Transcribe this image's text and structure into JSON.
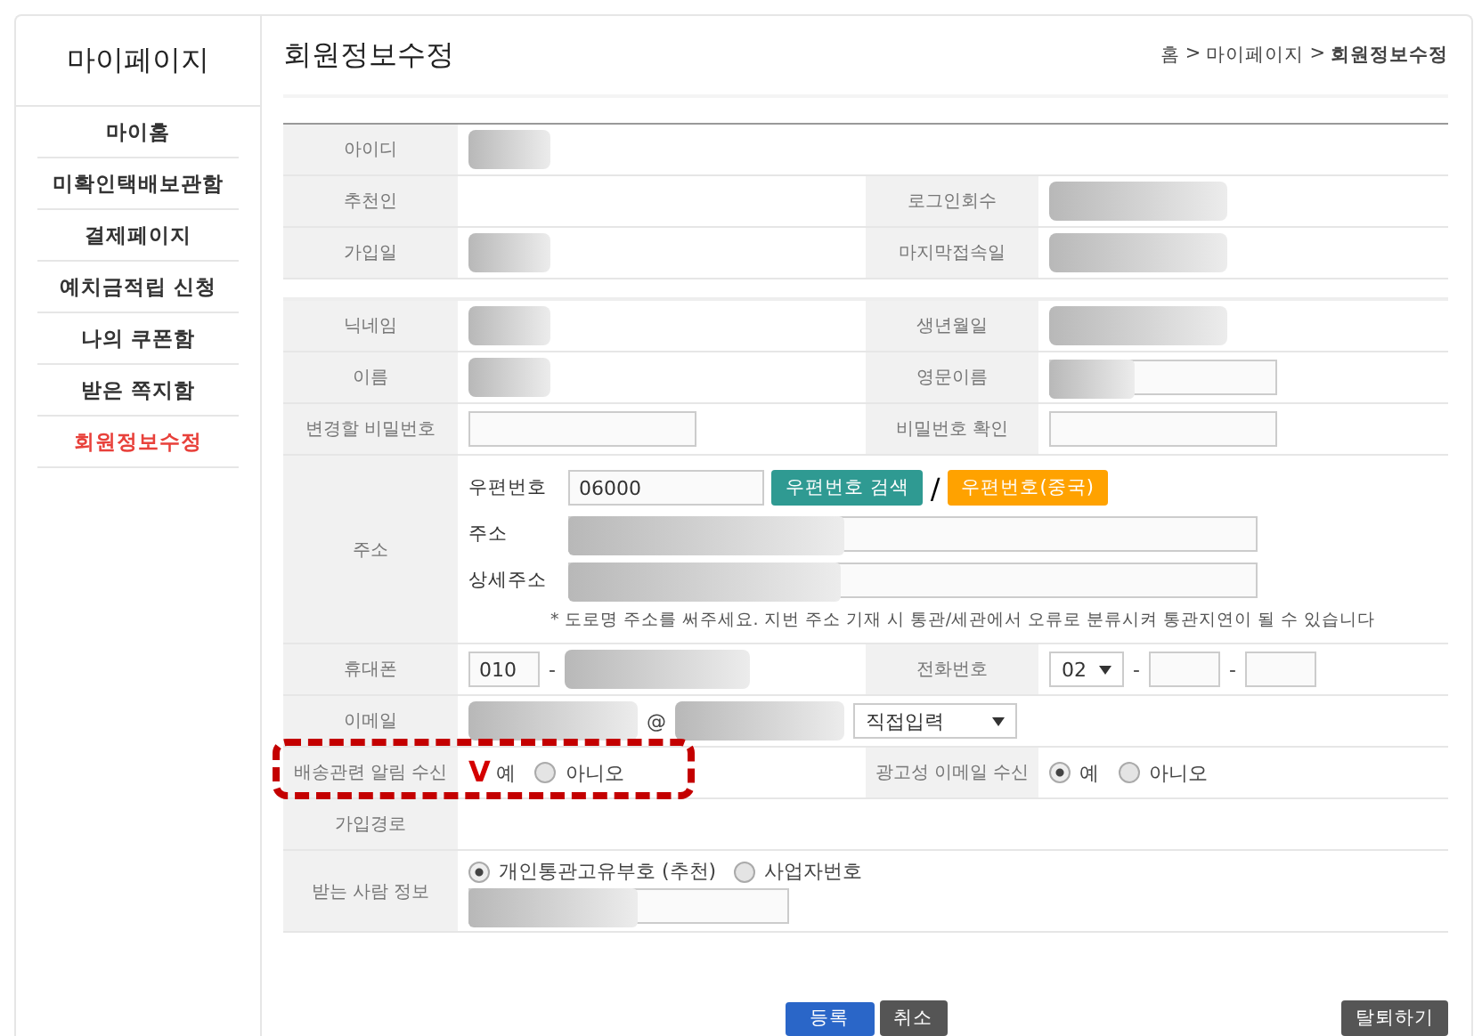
{
  "sidebar": {
    "title": "마이페이지",
    "items": [
      {
        "label": "마이홈",
        "selected": false
      },
      {
        "label": "미확인택배보관함",
        "selected": false
      },
      {
        "label": "결제페이지",
        "selected": false
      },
      {
        "label": "예치금적립 신청",
        "selected": false
      },
      {
        "label": "나의 쿠폰함",
        "selected": false
      },
      {
        "label": "받은 쪽지함",
        "selected": false
      },
      {
        "label": "회원정보수정",
        "selected": true
      }
    ]
  },
  "page_title": "회원정보수정",
  "breadcrumb": {
    "separator": ">",
    "items": [
      {
        "label": "홈",
        "current": false
      },
      {
        "label": "마이페이지",
        "current": false
      },
      {
        "label": "회원정보수정",
        "current": true
      }
    ]
  },
  "sections": [
    {
      "rows": [
        {
          "cells": [
            {
              "label": "아이디",
              "field": {
                "kind": "redacted"
              }
            }
          ]
        },
        {
          "cells": [
            {
              "label": "추천인",
              "field": {
                "kind": "blank"
              }
            },
            {
              "label": "로그인회수",
              "field": {
                "kind": "redacted"
              }
            }
          ]
        },
        {
          "cells": [
            {
              "label": "가입일",
              "field": {
                "kind": "redacted"
              }
            },
            {
              "label": "마지막접속일",
              "field": {
                "kind": "redacted"
              }
            }
          ]
        }
      ]
    },
    {
      "rows": [
        {
          "cells": [
            {
              "label": "닉네임",
              "field": {
                "kind": "redacted"
              }
            },
            {
              "label": "생년월일",
              "field": {
                "kind": "redacted"
              }
            }
          ]
        },
        {
          "cells": [
            {
              "label": "이름",
              "field": {
                "kind": "redacted"
              }
            },
            {
              "label": "영문이름",
              "field": {
                "kind": "input",
                "redacted": true
              }
            }
          ]
        },
        {
          "cells": [
            {
              "label": "변경할 비밀번호",
              "field": {
                "kind": "input",
                "redacted": false
              }
            },
            {
              "label": "비밀번호 확인",
              "field": {
                "kind": "input",
                "redacted": false
              }
            }
          ]
        },
        {
          "cells": [
            {
              "label": "주소",
              "field": {
                "kind": "address",
                "zip_label": "우편번호",
                "zip": "06000",
                "search_button": "우편번호 검색",
                "slash": "/",
                "china_button": "우편번호(중국)",
                "address_label": "주소",
                "detail_label": "상세주소",
                "note": "* 도로명 주소를 써주세요. 지번 주소 기재 시 통관/세관에서 오류로 분류시켜 통관지연이 될 수 있습니다"
              }
            }
          ]
        },
        {
          "cells": [
            {
              "label": "휴대폰",
              "field": {
                "kind": "mobile",
                "prefix": "010",
                "dash": "-"
              }
            },
            {
              "label": "전화번호",
              "field": {
                "kind": "tel",
                "area": "02",
                "dash": "-"
              }
            }
          ]
        },
        {
          "cells": [
            {
              "label": "이메일",
              "field": {
                "kind": "email",
                "at": "@",
                "domain": "직접입력"
              }
            }
          ]
        },
        {
          "annotation": {
            "mark": "V"
          },
          "cells": [
            {
              "label": "배송관련 알림 수신",
              "field": {
                "kind": "radio",
                "options": [
                  {
                    "label": "예",
                    "selected": true
                  },
                  {
                    "label": "아니오",
                    "selected": false
                  }
                ]
              }
            },
            {
              "label": "광고성 이메일 수신",
              "field": {
                "kind": "radio",
                "options": [
                  {
                    "label": "예",
                    "selected": true
                  },
                  {
                    "label": "아니오",
                    "selected": false
                  }
                ]
              }
            }
          ]
        },
        {
          "cells": [
            {
              "label": "가입경로",
              "field": {
                "kind": "blank"
              }
            }
          ]
        },
        {
          "cells": [
            {
              "label": "받는 사람 정보",
              "field": {
                "kind": "recipient",
                "options": [
                  {
                    "label": "개인통관고유부호 (추천)",
                    "selected": true
                  },
                  {
                    "label": "사업자번호",
                    "selected": false
                  }
                ]
              }
            }
          ]
        }
      ]
    }
  ],
  "buttons": {
    "submit": "등록",
    "cancel": "취소",
    "withdraw": "탈퇴하기"
  }
}
